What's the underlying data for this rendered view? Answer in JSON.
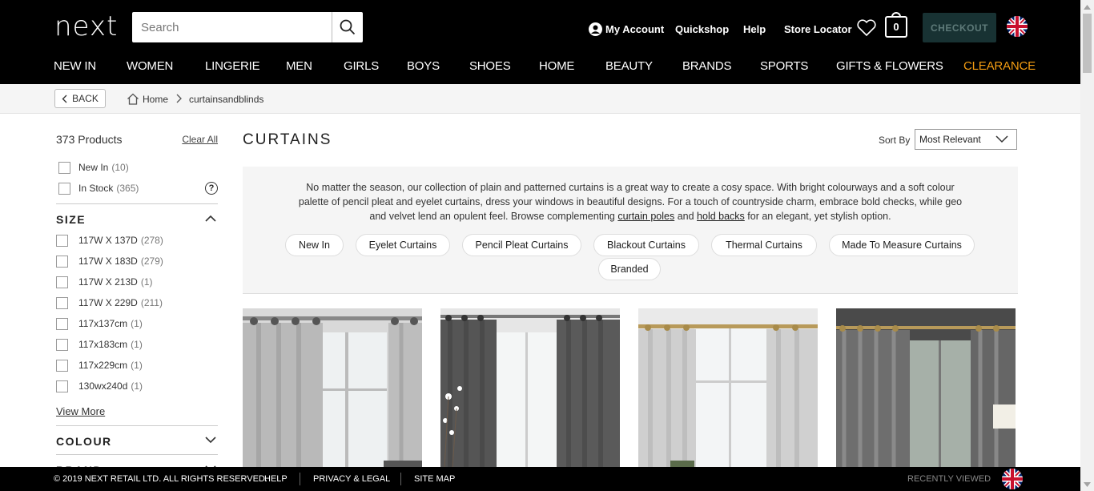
{
  "header": {
    "logo": "next",
    "search_placeholder": "Search",
    "links": {
      "my_account": "My Account",
      "quickshop": "Quickshop",
      "help": "Help",
      "store_locator": "Store Locator"
    },
    "bag_count": "0",
    "checkout_label": "CHECKOUT"
  },
  "nav": {
    "items": [
      "NEW IN",
      "WOMEN",
      "LINGERIE",
      "MEN",
      "GIRLS",
      "BOYS",
      "SHOES",
      "HOME",
      "BEAUTY",
      "BRANDS",
      "SPORTS",
      "GIFTS & FLOWERS",
      "CLEARANCE"
    ],
    "clearance_color": "#f39c12"
  },
  "breadcrumb": {
    "back_label": "BACK",
    "home": "Home",
    "current": "curtainsandblinds"
  },
  "sidebar": {
    "product_count": "373 Products",
    "clear_all": "Clear All",
    "quick_filters": [
      {
        "label": "New In",
        "count": "(10)"
      },
      {
        "label": "In Stock",
        "count": "(365)"
      }
    ],
    "size": {
      "heading": "SIZE",
      "options": [
        {
          "label": "117W X 137D",
          "count": "(278)"
        },
        {
          "label": "117W X 183D",
          "count": "(279)"
        },
        {
          "label": "117W X 213D",
          "count": "(1)"
        },
        {
          "label": "117W X 229D",
          "count": "(211)"
        },
        {
          "label": "117x137cm",
          "count": "(1)"
        },
        {
          "label": "117x183cm",
          "count": "(1)"
        },
        {
          "label": "117x229cm",
          "count": "(1)"
        },
        {
          "label": "130wx240d",
          "count": "(1)"
        }
      ],
      "view_more": "View More"
    },
    "colour_heading": "COLOUR",
    "brand_heading": "BRAND"
  },
  "main": {
    "title": "CURTAINS",
    "sort_label": "Sort By",
    "sort_value": "Most Relevant",
    "description": {
      "text_before": "No matter the season, our collection of plain and patterned curtains is a great way to create a cosy space. With bright colourways and a soft colour palette of pencil pleat and eyelet curtains, dress your windows in beautiful designs. For a touch of countryside charm, embrace bold checks, while geo and velvet lend an opulent feel. Browse complementing",
      "link1": "curtain poles",
      "and": "and",
      "link2": "hold backs",
      "text_after": "for an elegant, yet stylish option."
    },
    "pills": [
      "New In",
      "Eyelet Curtains",
      "Pencil Pleat Curtains",
      "Blackout Curtains",
      "Thermal Curtains",
      "Made To Measure Curtains",
      "Branded"
    ]
  },
  "footer": {
    "copyright": "© 2019 NEXT RETAIL LTD. ALL RIGHTS RESERVED.",
    "help": "HELP",
    "privacy": "PRIVACY & LEGAL",
    "sitemap": "SITE MAP",
    "recently_viewed": "RECENTLY VIEWED"
  }
}
